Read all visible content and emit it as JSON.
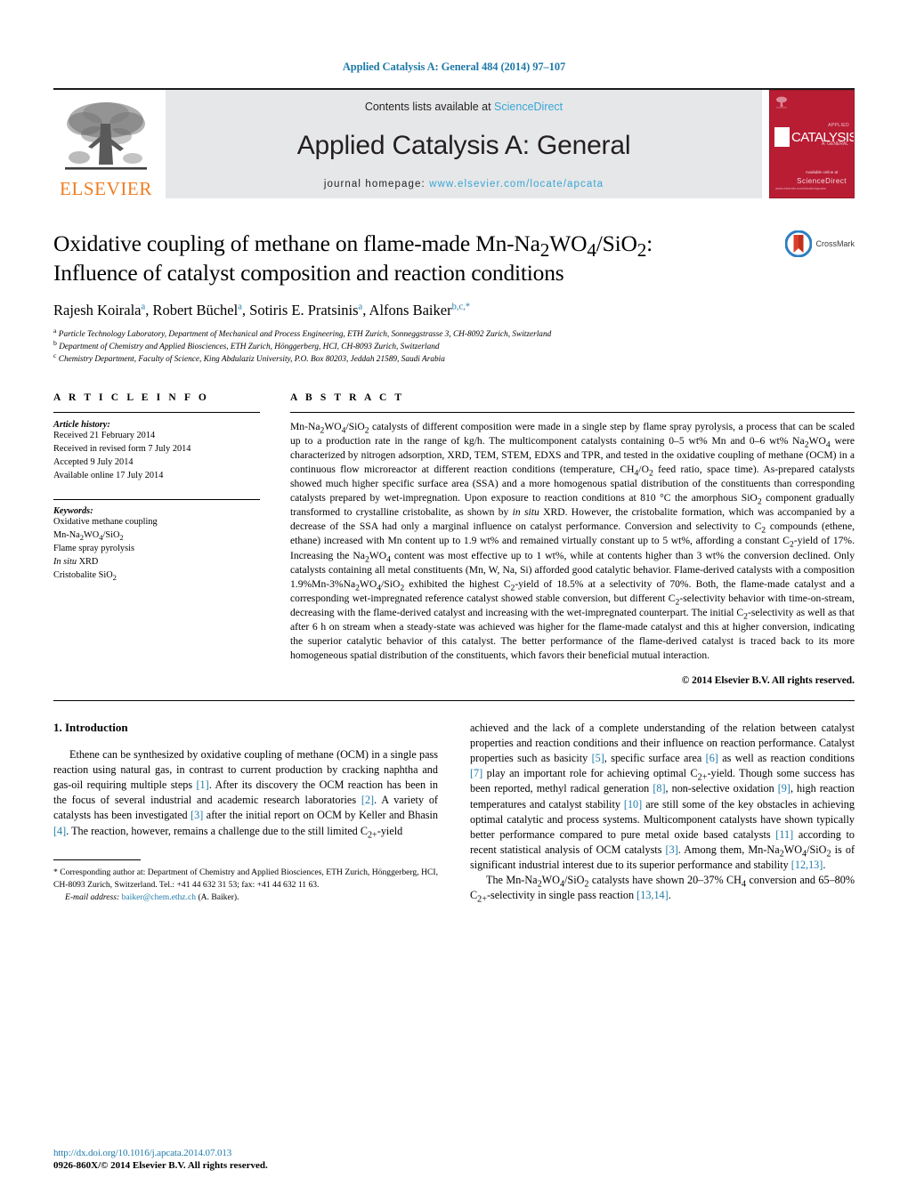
{
  "running_head": "Applied Catalysis A: General 484 (2014) 97–107",
  "masthead": {
    "publisher": "ELSEVIER",
    "contents_prefix": "Contents lists available at ",
    "sciencedirect": "ScienceDirect",
    "journal_name": "Applied Catalysis A: General",
    "homepage_prefix": "journal homepage: ",
    "homepage_url": "www.elsevier.com/locate/apcata",
    "cover": {
      "title": "CATALYSIS",
      "sub_top": "APPLIED",
      "sub_bottom": "A: GENERAL",
      "footer_big": "ScienceDirect",
      "footer_small": "Available online at",
      "bottom_left": "www.elsevier.com/locate/apcata"
    },
    "accent_blue": "#3aa5d6",
    "elsevier_orange": "#ef7d22",
    "cover_red": "#b81d34"
  },
  "article": {
    "title_line1": "Oxidative coupling of methane on flame-made Mn-Na",
    "title_line1_sub1": "2",
    "title_line1_mid": "WO",
    "title_line1_sub2": "4",
    "title_line1_slash": "/SiO",
    "title_line1_sub3": "2",
    "title_line1_end": ":",
    "title_line2": "Influence of catalyst composition and reaction conditions",
    "crossmark_label": "CrossMark",
    "authors": [
      {
        "name": "Rajesh Koirala",
        "marks": "a"
      },
      {
        "name": "Robert Büchel",
        "marks": "a"
      },
      {
        "name": "Sotiris E. Pratsinis",
        "marks": "a"
      },
      {
        "name": "Alfons Baiker",
        "marks": "b,c,*"
      }
    ],
    "affiliations": [
      {
        "mark": "a",
        "text": "Particle Technology Laboratory, Department of Mechanical and Process Engineering, ETH Zurich, Sonneggstrasse 3, CH-8092 Zurich, Switzerland"
      },
      {
        "mark": "b",
        "text": "Department of Chemistry and Applied Biosciences, ETH Zurich, Hönggerberg, HCI, CH-8093 Zurich, Switzerland"
      },
      {
        "mark": "c",
        "text": "Chemistry Department, Faculty of Science, King Abdulaziz University, P.O. Box 80203, Jeddah 21589, Saudi Arabia"
      }
    ]
  },
  "article_info": {
    "label": "A R T I C L E    I N F O",
    "history_head": "Article history:",
    "history": [
      "Received 21 February 2014",
      "Received in revised form 7 July 2014",
      "Accepted 9 July 2014",
      "Available online 17 July 2014"
    ],
    "keywords_head": "Keywords:",
    "keywords": [
      "Oxidative methane coupling",
      "Mn-Na2WO4/SiO2",
      "Flame spray pyrolysis",
      "In situ XRD",
      "Cristobalite SiO2"
    ]
  },
  "abstract": {
    "label": "A B S T R A C T",
    "text": "Mn-Na2WO4/SiO2 catalysts of different composition were made in a single step by flame spray pyrolysis, a process that can be scaled up to a production rate in the range of kg/h. The multicomponent catalysts containing 0–5 wt% Mn and 0–6 wt% Na2WO4 were characterized by nitrogen adsorption, XRD, TEM, STEM, EDXS and TPR, and tested in the oxidative coupling of methane (OCM) in a continuous flow microreactor at different reaction conditions (temperature, CH4/O2 feed ratio, space time). As-prepared catalysts showed much higher specific surface area (SSA) and a more homogenous spatial distribution of the constituents than corresponding catalysts prepared by wet-impregnation. Upon exposure to reaction conditions at 810 °C the amorphous SiO2 component gradually transformed to crystalline cristobalite, as shown by in situ XRD. However, the cristobalite formation, which was accompanied by a decrease of the SSA had only a marginal influence on catalyst performance. Conversion and selectivity to C2 compounds (ethene, ethane) increased with Mn content up to 1.9 wt% and remained virtually constant up to 5 wt%, affording a constant C2-yield of 17%. Increasing the Na2WO4 content was most effective up to 1 wt%, while at contents higher than 3 wt% the conversion declined. Only catalysts containing all metal constituents (Mn, W, Na, Si) afforded good catalytic behavior. Flame-derived catalysts with a composition 1.9%Mn-3%Na2WO4/SiO2 exhibited the highest C2-yield of 18.5% at a selectivity of 70%. Both, the flame-made catalyst and a corresponding wet-impregnated reference catalyst showed stable conversion, but different C2-selectivity behavior with time-on-stream, decreasing with the flame-derived catalyst and increasing with the wet-impregnated counterpart. The initial C2-selectivity as well as that after 6 h on stream when a steady-state was achieved was higher for the flame-made catalyst and this at higher conversion, indicating the superior catalytic behavior of this catalyst. The better performance of the flame-derived catalyst is traced back to its more homogeneous spatial distribution of the constituents, which favors their beneficial mutual interaction.",
    "copyright": "© 2014 Elsevier B.V. All rights reserved."
  },
  "introduction": {
    "heading": "1.  Introduction",
    "left_paragraph": "Ethene can be synthesized by oxidative coupling of methane (OCM) in a single pass reaction using natural gas, in contrast to current production by cracking naphtha and gas-oil requiring multiple steps [1]. After its discovery the OCM reaction has been in the focus of several industrial and academic research laboratories [2]. A variety of catalysts has been investigated [3] after the initial report on OCM by Keller and Bhasin [4]. The reaction, however, remains a challenge due to the still limited C2+-yield",
    "right_paragraph_1": "achieved and the lack of a complete understanding of the relation between catalyst properties and reaction conditions and their influence on reaction performance. Catalyst properties such as basicity [5], specific surface area [6] as well as reaction conditions [7] play an important role for achieving optimal C2+-yield. Though some success has been reported, methyl radical generation [8], non-selective oxidation [9], high reaction temperatures and catalyst stability [10] are still some of the key obstacles in achieving optimal catalytic and process systems. Multicomponent catalysts have shown typically better performance compared to pure metal oxide based catalysts [11] according to recent statistical analysis of OCM catalysts [3]. Among them, Mn-Na2WO4/SiO2 is of significant industrial interest due to its superior performance and stability [12,13].",
    "right_paragraph_2": "The Mn-Na2WO4/SiO2 catalysts have shown 20–37% CH4 conversion and 65–80% C2+-selectivity in single pass reaction [13,14]."
  },
  "footnote": {
    "star": "*",
    "text": " Corresponding author at: Department of Chemistry and Applied Biosciences, ETH Zurich, Hönggerberg, HCI, CH-8093 Zurich, Switzerland. Tel.: +41 44 632 31 53; fax: +41 44 632 11 63.",
    "email_label": "E-mail address:",
    "email": "baiker@chem.ethz.ch",
    "email_owner": "(A. Baiker)."
  },
  "imprint": {
    "doi": "http://dx.doi.org/10.1016/j.apcata.2014.07.013",
    "issn_line": "0926-860X/© 2014 Elsevier B.V. All rights reserved."
  }
}
